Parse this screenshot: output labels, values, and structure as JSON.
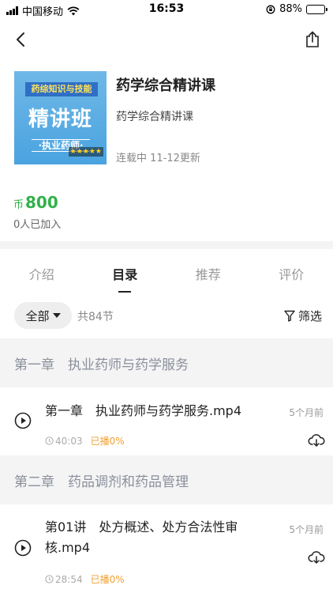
{
  "status_bar": {
    "carrier": "中国移动",
    "time": "16:53",
    "battery": "88%",
    "battery_level": 0.88
  },
  "course": {
    "cover": {
      "top_text": "药综知识与技能",
      "main_text": "精讲班",
      "sub_text": "·执业药师·",
      "stars": "★★★★★"
    },
    "title": "药学综合精讲课",
    "subtitle": "药学综合精讲课",
    "update_status": "连载中 11-12更新",
    "price_coin": "币",
    "price_amount": "800",
    "joined": "0人已加入"
  },
  "tabs": [
    {
      "label": "介绍",
      "active": false
    },
    {
      "label": "目录",
      "active": true
    },
    {
      "label": "推荐",
      "active": false
    },
    {
      "label": "评价",
      "active": false
    }
  ],
  "filter": {
    "all_label": "全部",
    "count_label": "共84节",
    "filter_label": "筛选"
  },
  "chapters": [
    {
      "title": "第一章　执业药师与药学服务",
      "lessons": [
        {
          "title": "第一章　执业药师与药学服务.mp4",
          "ago": "5个月前",
          "duration": "40:03",
          "played": "已播0%"
        }
      ]
    },
    {
      "title": "第二章　药品调剂和药品管理",
      "lessons": [
        {
          "title_line1": "第01讲　处方概述、处方合法性审",
          "title_line2": "核.mp4",
          "ago": "5个月前",
          "duration": "28:54",
          "played": "已播0%"
        }
      ]
    }
  ],
  "colors": {
    "price_green": "#33b14a",
    "played_orange": "#f0a030",
    "chapter_text": "#8a8f9c"
  }
}
